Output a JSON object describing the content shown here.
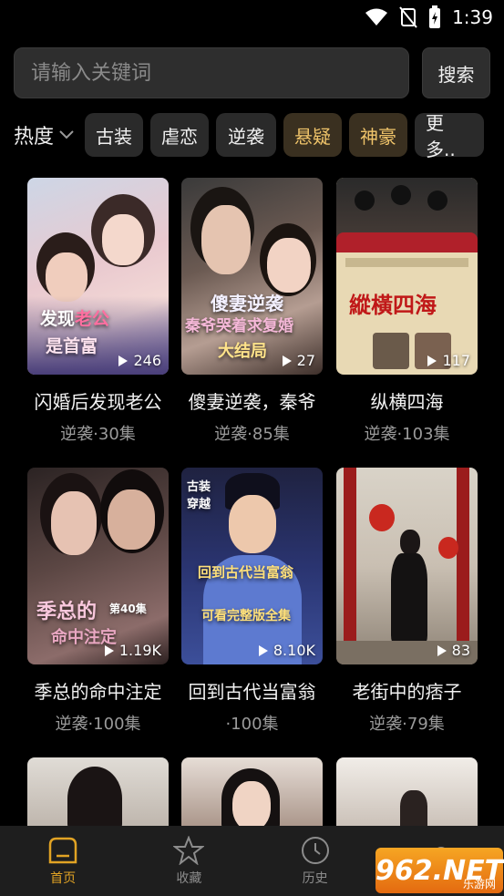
{
  "status": {
    "time": "1:39"
  },
  "search": {
    "placeholder": "请输入关键词",
    "button_label": "搜索"
  },
  "filters": {
    "sort_label": "热度",
    "chips": [
      {
        "label": "古装",
        "highlight": false
      },
      {
        "label": "虐恋",
        "highlight": false
      },
      {
        "label": "逆袭",
        "highlight": false
      },
      {
        "label": "悬疑",
        "highlight": true
      },
      {
        "label": "神豪",
        "highlight": true
      },
      {
        "label": "更多..",
        "highlight": false
      }
    ]
  },
  "cards": [
    {
      "title": "闪婚后发现老公",
      "meta": "逆袭·30集",
      "plays": "246",
      "overlay": "发现老公是首富"
    },
    {
      "title": "傻妻逆袭，秦爷",
      "meta": "逆袭·85集",
      "plays": "27",
      "overlay": "傻妻逆袭 秦爷哭着求复婚 大结局"
    },
    {
      "title": "纵横四海",
      "meta": "逆袭·103集",
      "plays": "117",
      "overlay": "縱橫四海"
    },
    {
      "title": "季总的命中注定",
      "meta": "逆袭·100集",
      "plays": "1.19K",
      "overlay": "季总的命中注定 第40集"
    },
    {
      "title": "回到古代当富翁",
      "meta": "·100集",
      "plays": "8.10K",
      "overlay": "古装穿越 回到古代当富翁 完整版全集"
    },
    {
      "title": "老街中的痞子",
      "meta": "逆袭·79集",
      "plays": "83",
      "overlay": ""
    }
  ],
  "tabs": [
    {
      "label": "首页",
      "icon": "home-icon",
      "active": true
    },
    {
      "label": "收藏",
      "icon": "star-icon",
      "active": false
    },
    {
      "label": "历史",
      "icon": "clock-icon",
      "active": false
    },
    {
      "label": "",
      "icon": "user-icon",
      "active": false
    }
  ],
  "watermark": {
    "text": "962.NET",
    "sub": "乐游网"
  },
  "colors": {
    "accent": "#e1a324",
    "highlight_chip_text": "#f0c46a",
    "background": "#000000"
  }
}
